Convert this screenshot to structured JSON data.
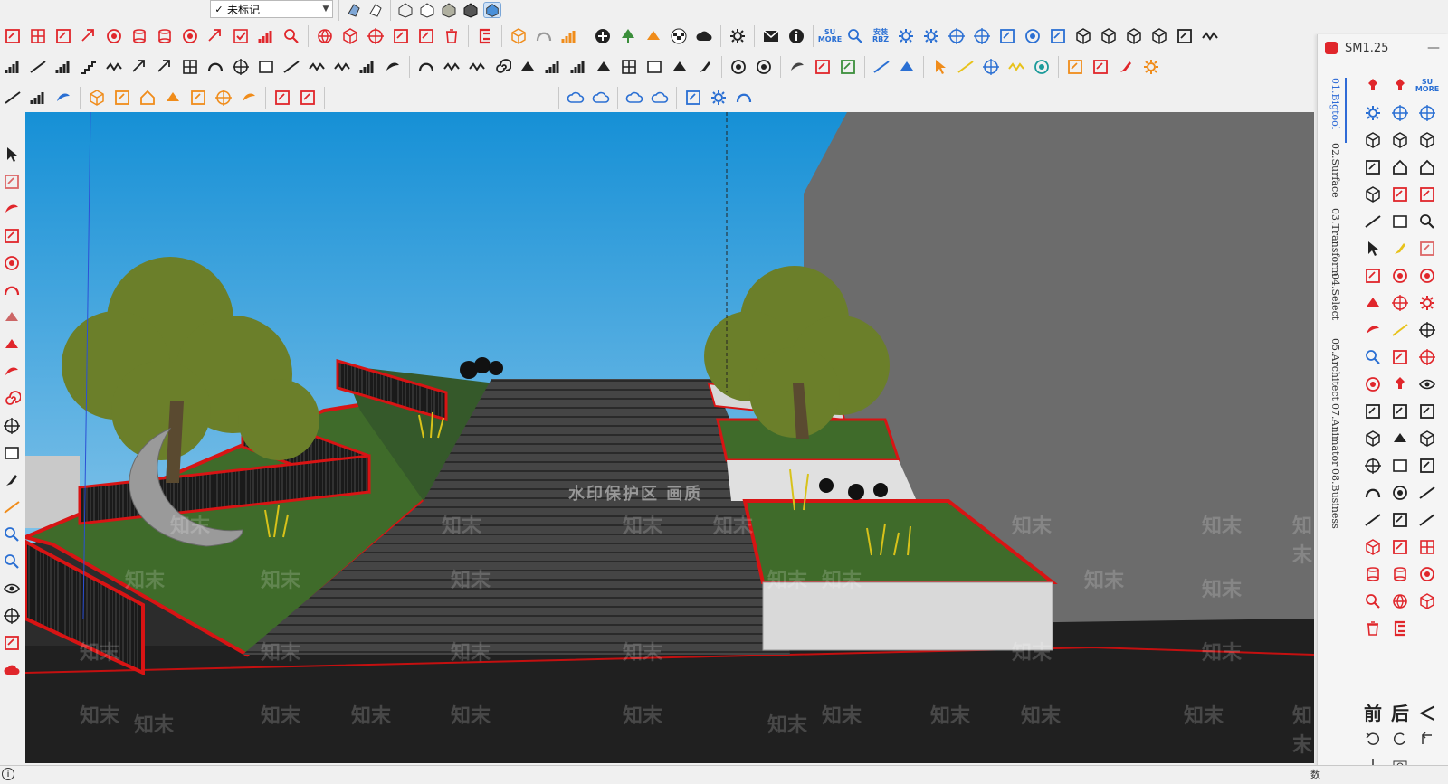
{
  "tag_dropdown": {
    "check": "✓",
    "selected": "未标记"
  },
  "panel": {
    "title": "SM1.25",
    "minimize": "—",
    "tabs": [
      "01.Bigtool",
      "02.Surface",
      "03.Transform",
      "04.Select",
      "05.Architect",
      "07.Animator",
      "08.Business"
    ],
    "bottom_labels": {
      "front": "前",
      "back": "后",
      "left_arrow": "＜"
    }
  },
  "viewport": {
    "watermark_center": "水印保护区  画质",
    "watermark_tiles": [
      "知末",
      "知末",
      "知末",
      "知末",
      "知末",
      "知末",
      "知末",
      "知末",
      "知末",
      "知末",
      "知末",
      "知末",
      "知末",
      "知末",
      "知末",
      "知末",
      "知末",
      "知末",
      "知末",
      "知末",
      "知末",
      "知末",
      "知末",
      "知末",
      "知末",
      "知末",
      "知末",
      "知末",
      "知末",
      "知末",
      "知末",
      "知末"
    ]
  },
  "toolbar_badges": {
    "su_more": "SU\nMORE",
    "rbz": "安装\nRBZ"
  },
  "status_bar": {
    "info": "i",
    "cursor_text": "数"
  },
  "colors": {
    "accent_red": "#e0262b",
    "sky_top": "#1a8fd8",
    "sky_bottom": "#a8d4f0",
    "grass": "#3f6b2a",
    "rail_red": "#d81414",
    "stair_dark": "#3b3b3b",
    "wall_grey": "#6c6c6c",
    "panel_tab_active": "#2f6bd6"
  }
}
